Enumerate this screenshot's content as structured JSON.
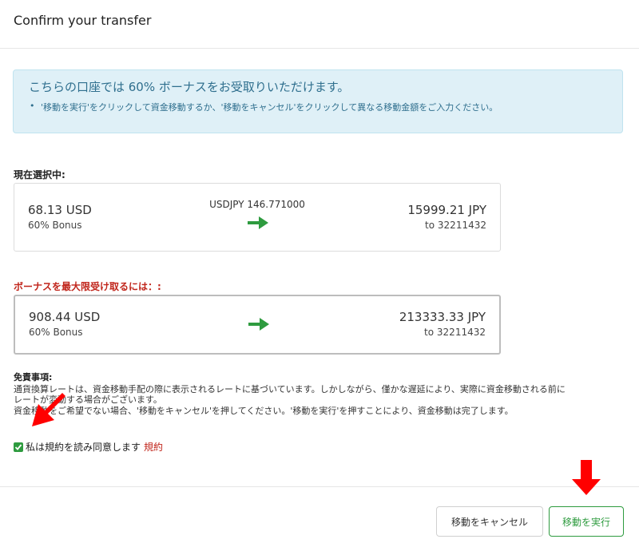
{
  "header": {
    "title": "Confirm your transfer"
  },
  "info": {
    "heading": "こちらの口座では 60% ボーナスをお受取りいただけます。",
    "bullet": "•",
    "item": "'移動を実行'をクリックして資金移動するか、'移動をキャンセル'をクリックして異なる移動金額をご入力ください。"
  },
  "current": {
    "label": "現在選択中:",
    "from_amount": "68.13 USD",
    "from_bonus": "60% Bonus",
    "rate": "USDJPY 146.771000",
    "to_amount": "15999.21 JPY",
    "to_account": "to 32211432"
  },
  "max": {
    "label": "ボーナスを最大限受け取るには：:",
    "from_amount": "908.44 USD",
    "from_bonus": "60% Bonus",
    "to_amount": "213333.33 JPY",
    "to_account": "to 32211432"
  },
  "disclaimer": {
    "title": "免責事項:",
    "line1": "通貨換算レートは、資金移動手配の際に表示されるレートに基づいています。しかしながら、僅かな遅延により、実際に資金移動される前に",
    "line2": "レートが変動する場合がございます。",
    "line3": "資金移動をご希望でない場合、'移動をキャンセル'を押してください。'移動を実行'を押すことにより、資金移動は完了します。"
  },
  "agree": {
    "label": "私は規約を読み同意します",
    "terms_link": "規約",
    "checked": true
  },
  "buttons": {
    "cancel": "移動をキャンセル",
    "execute": "移動を実行"
  },
  "colors": {
    "accent_green": "#2e9b3f",
    "warning_red": "#c0241a",
    "info_bg": "#dff0f7",
    "info_text": "#2f6f8e",
    "annotation_red": "#ff0000"
  }
}
